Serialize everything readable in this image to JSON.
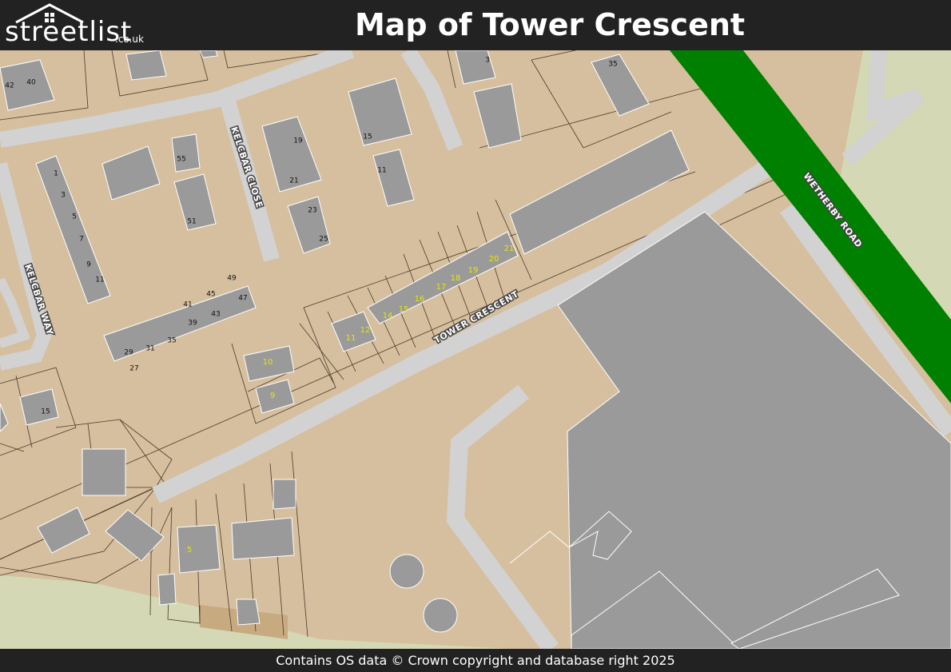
{
  "header": {
    "logo_main": "streetlist",
    "logo_sub": ".co.uk",
    "title": "Map of Tower Crescent"
  },
  "footer": {
    "attribution": "Contains OS data © Crown copyright and database right 2025"
  },
  "colors": {
    "header_bg": "#222222",
    "land": "#d6bf9e",
    "building": "#9a9a9a",
    "road": "#d2d2d2",
    "main_road": "#008000",
    "parcel_line": "#4a3a2a",
    "highlight_number": "#e6e600",
    "grass": "#d5d8b4"
  },
  "map": {
    "road_labels": {
      "kelcbar_close": "KELCBAR CLOSE",
      "kelcbar_way": "KELCBAR WAY",
      "tower_crescent": "TOWER CRESCENT",
      "wetherby_road": "WETHERBY ROAD"
    },
    "house_numbers": {
      "n42": "42",
      "n40": "40",
      "n3_top": "3",
      "n35_top": "35",
      "n55": "55",
      "n19_close": "19",
      "n15_close": "15",
      "n11_close": "11",
      "n21_close": "21",
      "n23": "23",
      "n25": "25",
      "n51": "51",
      "n1": "1",
      "n3": "3",
      "n5": "5",
      "n7": "7",
      "n9": "9",
      "n11": "11",
      "n49": "49",
      "n45": "45",
      "n47": "47",
      "n41": "41",
      "n43": "43",
      "n39": "39",
      "n35": "35",
      "n31": "31",
      "n29": "29",
      "n27": "27",
      "n15_left": "15",
      "t10": "10",
      "t9": "9",
      "t11": "11",
      "t12": "12",
      "t14": "14",
      "t15": "15",
      "t16": "16",
      "t17": "17",
      "t18": "18",
      "t19": "19",
      "t20": "20",
      "t21": "21",
      "t5": "5"
    }
  }
}
